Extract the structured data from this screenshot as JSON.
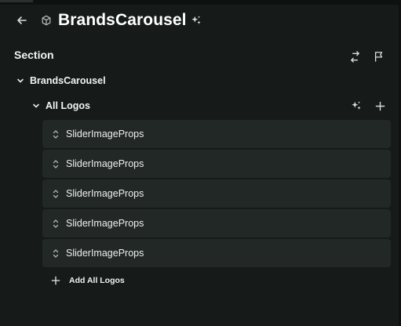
{
  "header": {
    "title": "BrandsCarousel",
    "icons": [
      "back-arrow-icon",
      "cube-icon",
      "sparkle-icon"
    ]
  },
  "section": {
    "title": "Section",
    "icons": [
      "swap-icon",
      "flag-icon"
    ]
  },
  "tree": {
    "root_label": "BrandsCarousel",
    "group_label": "All Logos",
    "items": [
      {
        "label": "SliderImageProps"
      },
      {
        "label": "SliderImageProps"
      },
      {
        "label": "SliderImageProps"
      },
      {
        "label": "SliderImageProps"
      },
      {
        "label": "SliderImageProps"
      }
    ],
    "add_label": "Add All Logos"
  }
}
